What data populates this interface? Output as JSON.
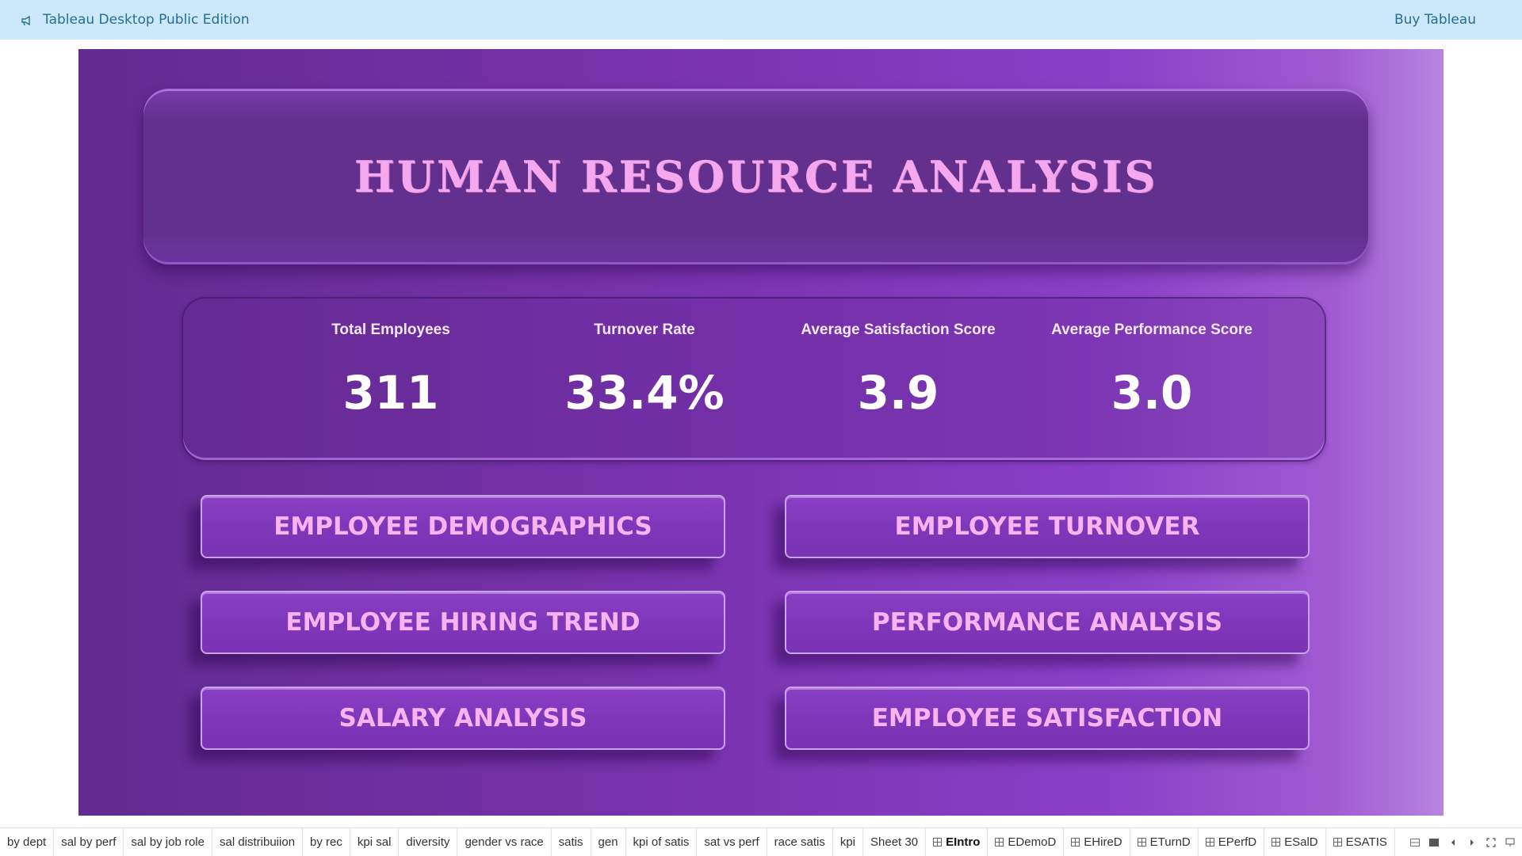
{
  "topbar": {
    "title": "Tableau Desktop Public Edition",
    "buy_label": "Buy Tableau",
    "icon": "megaphone-icon"
  },
  "dashboard": {
    "title": "HUMAN RESOURCE ANALYSIS",
    "kpis": [
      {
        "label": "Total Employees",
        "value": "311"
      },
      {
        "label": "Turnover Rate",
        "value": "33.4%"
      },
      {
        "label": "Average Satisfaction Score",
        "value": "3.9"
      },
      {
        "label": "Average Performance Score",
        "value": "3.0"
      }
    ],
    "buttons": [
      {
        "label": "EMPLOYEE DEMOGRAPHICS"
      },
      {
        "label": "EMPLOYEE TURNOVER"
      },
      {
        "label": "EMPLOYEE HIRING TREND"
      },
      {
        "label": "PERFORMANCE ANALYSIS"
      },
      {
        "label": "SALARY ANALYSIS"
      },
      {
        "label": "EMPLOYEE SATISFACTION"
      }
    ],
    "colors": {
      "title_text": "#f6a8ef",
      "button_text": "#f8b3f0",
      "background_start": "#632a91",
      "background_end": "#b884e0"
    }
  },
  "tabs": [
    {
      "label": "by dept"
    },
    {
      "label": "sal by perf"
    },
    {
      "label": "sal by job role"
    },
    {
      "label": "sal distribuiion"
    },
    {
      "label": "by rec"
    },
    {
      "label": "kpi sal"
    },
    {
      "label": "diversity"
    },
    {
      "label": "gender vs race"
    },
    {
      "label": "satis"
    },
    {
      "label": "gen"
    },
    {
      "label": "kpi of satis"
    },
    {
      "label": "sat vs perf"
    },
    {
      "label": "race satis"
    },
    {
      "label": "kpi"
    },
    {
      "label": "Sheet 30"
    },
    {
      "label": "EIntro",
      "dashboard": true,
      "active": true
    },
    {
      "label": "EDemoD",
      "dashboard": true
    },
    {
      "label": "EHireD",
      "dashboard": true
    },
    {
      "label": "ETurnD",
      "dashboard": true
    },
    {
      "label": "EPerfD",
      "dashboard": true
    },
    {
      "label": "ESalD",
      "dashboard": true
    },
    {
      "label": "ESATIS",
      "dashboard": true
    }
  ],
  "tab_controls": [
    "show-sheets-icon",
    "filmstrip-icon",
    "prev-icon",
    "next-icon",
    "fullscreen-icon",
    "presentation-icon"
  ]
}
